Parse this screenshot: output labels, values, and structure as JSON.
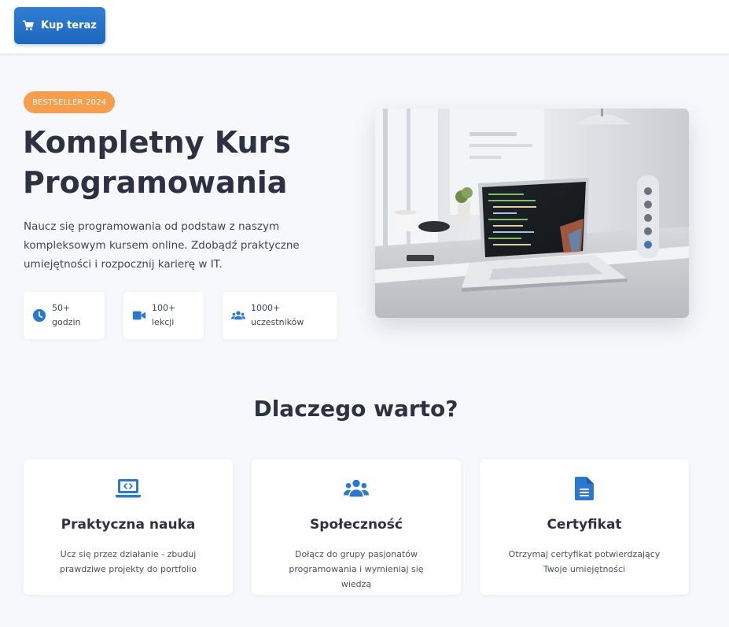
{
  "header": {
    "buy_label": "Kup teraz"
  },
  "hero": {
    "badge": "BESTSELLER 2024",
    "title_line1": "Kompletny Kurs",
    "title_line2": "Programowania",
    "description": "Naucz się programowania od podstaw z naszym kompleksowym kursem online. Zdobądź praktyczne umiejętności i rozpocznij karierę w IT.",
    "stats": [
      {
        "icon": "clock-icon",
        "value": "50+",
        "label": "godzin"
      },
      {
        "icon": "video-icon",
        "value": "100+",
        "label": "lekcji"
      },
      {
        "icon": "users-icon",
        "value": "1000+",
        "label": "uczestników"
      }
    ]
  },
  "why": {
    "title": "Dlaczego warto?",
    "features": [
      {
        "icon": "laptop-code-icon",
        "title": "Praktyczna nauka",
        "description": "Ucz się przez działanie - zbuduj prawdziwe projekty do portfolio"
      },
      {
        "icon": "users-icon",
        "title": "Społeczność",
        "description": "Dołącz do grupy pasjonatów programowania i wymieniaj się wiedzą"
      },
      {
        "icon": "certificate-icon",
        "title": "Certyfikat",
        "description": "Otrzymaj certyfikat potwierdzający Twoje umiejętności"
      }
    ]
  },
  "colors": {
    "primary": "#2b78cf",
    "accent": "#f59e4d",
    "text": "#2d3142"
  }
}
